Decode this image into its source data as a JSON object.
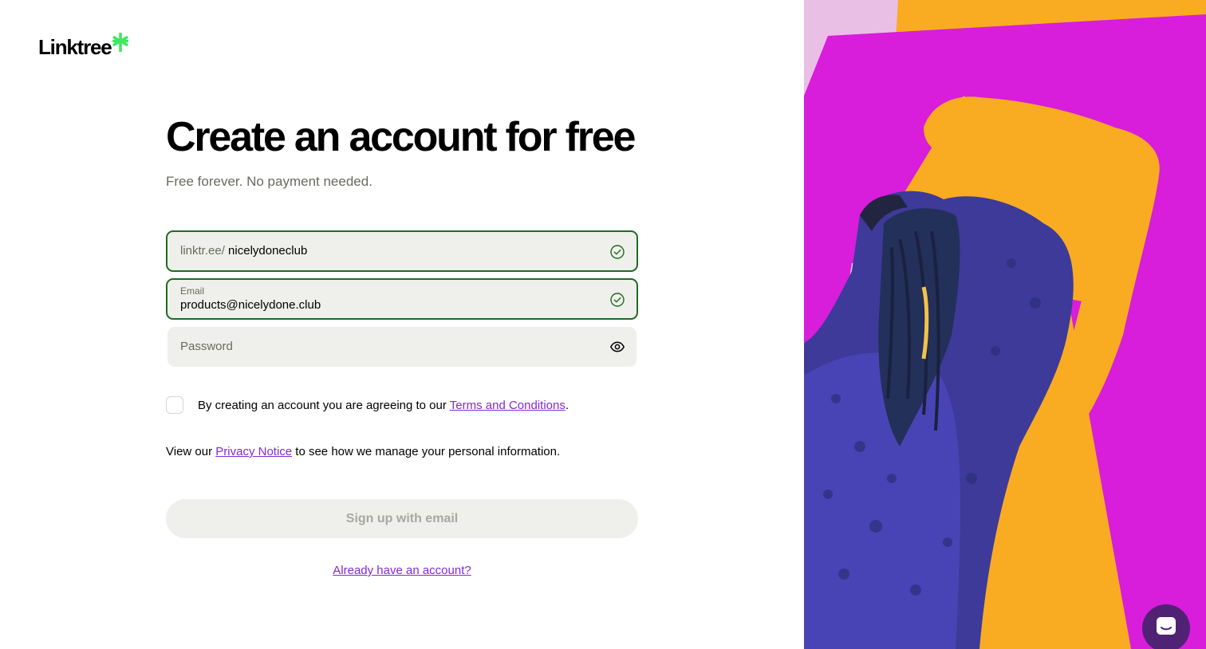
{
  "brand": {
    "name": "Linktree",
    "accent": "#43e660"
  },
  "page": {
    "title": "Create an account for free",
    "subtitle": "Free forever. No payment needed."
  },
  "form": {
    "username": {
      "prefix": "linktr.ee/",
      "value": "nicelydoneclub",
      "status_icon": "check-circle-icon"
    },
    "email": {
      "label": "Email",
      "value": "products@nicelydone.club",
      "status_icon": "check-circle-icon"
    },
    "password": {
      "placeholder": "Password",
      "toggle_icon": "eye-icon"
    },
    "terms": {
      "prefix": "By creating an account you are agreeing to our ",
      "link": "Terms and Conditions",
      "suffix": "."
    },
    "privacy": {
      "prefix": "View our ",
      "link": "Privacy Notice",
      "suffix": " to see how we manage your personal information."
    },
    "submit_label": "Sign up with email",
    "login_link": "Already have an account?"
  },
  "colors": {
    "valid_border": "#1e6b22",
    "link": "#8129d9",
    "field_bg": "#eff0ec",
    "hero_magenta": "#d81ddb",
    "hero_orange": "#f9ac22",
    "hero_pink": "#e9bfe6",
    "chat_button": "#502274"
  },
  "chat": {
    "icon": "chat-icon"
  }
}
